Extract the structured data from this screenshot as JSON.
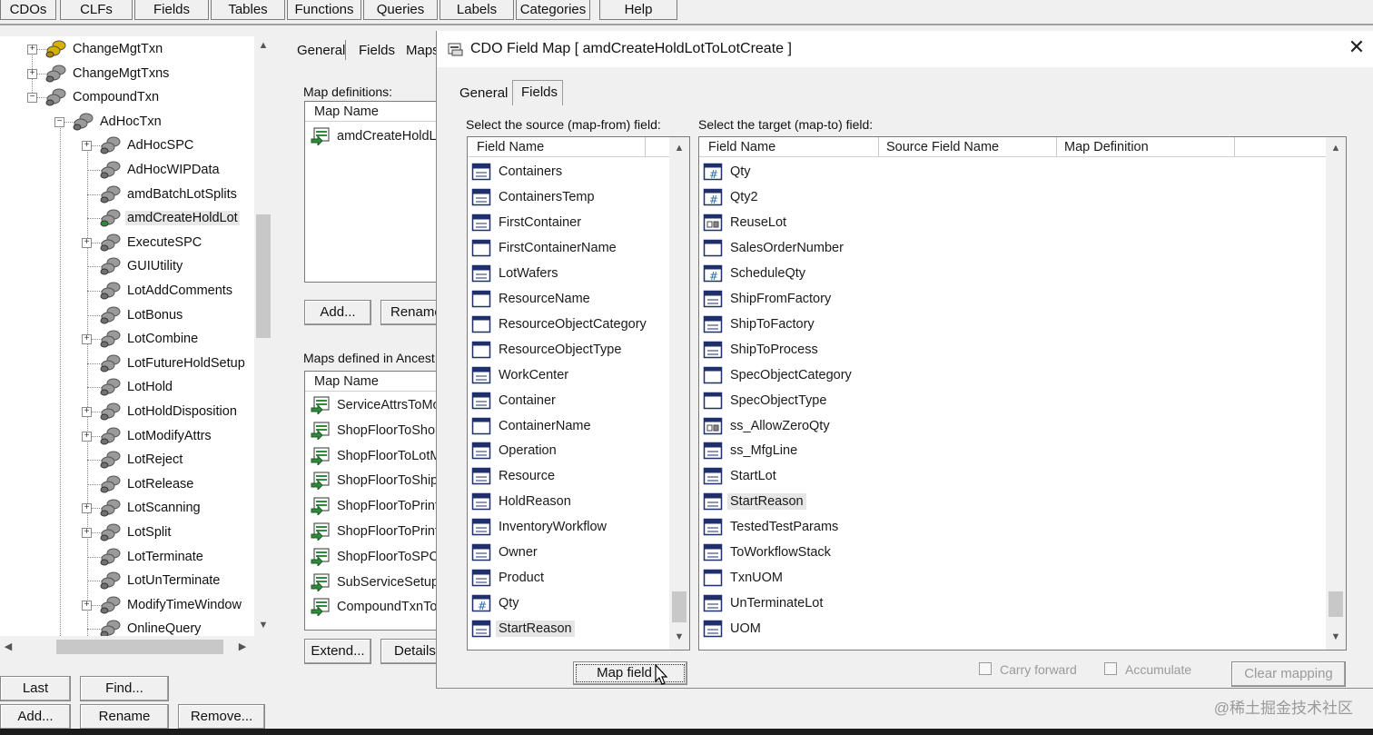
{
  "menu": [
    "CDOs",
    "CLFs",
    "Fields",
    "Tables",
    "Functions",
    "Queries",
    "Labels",
    "Categories",
    "Help"
  ],
  "tree": {
    "items": [
      {
        "label": "ChangeMgtTxn",
        "level": 0,
        "expander": "+",
        "icon": "gold"
      },
      {
        "label": "ChangeMgtTxns",
        "level": 0,
        "expander": "+",
        "icon": "gray"
      },
      {
        "label": "CompoundTxn",
        "level": 0,
        "expander": "-",
        "icon": "gray"
      },
      {
        "label": "AdHocTxn",
        "level": 1,
        "expander": "-",
        "icon": "gray"
      },
      {
        "label": "AdHocSPC",
        "level": 2,
        "expander": "+",
        "icon": "gray"
      },
      {
        "label": "AdHocWIPData",
        "level": 2,
        "expander": "",
        "icon": "gray"
      },
      {
        "label": "amdBatchLotSplits",
        "level": 2,
        "expander": "",
        "icon": "gray"
      },
      {
        "label": "amdCreateHoldLot",
        "level": 2,
        "expander": "",
        "icon": "green",
        "selected": true
      },
      {
        "label": "ExecuteSPC",
        "level": 2,
        "expander": "+",
        "icon": "gray"
      },
      {
        "label": "GUIUtility",
        "level": 2,
        "expander": "",
        "icon": "gray"
      },
      {
        "label": "LotAddComments",
        "level": 2,
        "expander": "",
        "icon": "gray"
      },
      {
        "label": "LotBonus",
        "level": 2,
        "expander": "",
        "icon": "gray"
      },
      {
        "label": "LotCombine",
        "level": 2,
        "expander": "+",
        "icon": "gray"
      },
      {
        "label": "LotFutureHoldSetup",
        "level": 2,
        "expander": "",
        "icon": "gray"
      },
      {
        "label": "LotHold",
        "level": 2,
        "expander": "",
        "icon": "gray"
      },
      {
        "label": "LotHoldDisposition",
        "level": 2,
        "expander": "+",
        "icon": "gray"
      },
      {
        "label": "LotModifyAttrs",
        "level": 2,
        "expander": "+",
        "icon": "gray"
      },
      {
        "label": "LotReject",
        "level": 2,
        "expander": "",
        "icon": "gray"
      },
      {
        "label": "LotRelease",
        "level": 2,
        "expander": "",
        "icon": "gray"
      },
      {
        "label": "LotScanning",
        "level": 2,
        "expander": "+",
        "icon": "gray"
      },
      {
        "label": "LotSplit",
        "level": 2,
        "expander": "+",
        "icon": "gray"
      },
      {
        "label": "LotTerminate",
        "level": 2,
        "expander": "",
        "icon": "gray"
      },
      {
        "label": "LotUnTerminate",
        "level": 2,
        "expander": "",
        "icon": "gray"
      },
      {
        "label": "ModifyTimeWindow",
        "level": 2,
        "expander": "+",
        "icon": "gray"
      },
      {
        "label": "OnlineQuery",
        "level": 2,
        "expander": "",
        "icon": "gray"
      }
    ]
  },
  "left_buttons": {
    "last": "Last",
    "find": "Find...",
    "add": "Add...",
    "rename": "Rename",
    "remove": "Remove..."
  },
  "middle": {
    "tabs": [
      "General",
      "Fields",
      "Maps"
    ],
    "map_definitions_label": "Map definitions:",
    "map_name_header": "Map Name",
    "map_definitions": [
      "amdCreateHoldLo"
    ],
    "add_button": "Add...",
    "rename_button": "Rename",
    "ancestors_label": "Maps defined in Ancest",
    "ancestor_header": "Map Name",
    "ancestor_maps": [
      "ServiceAttrsToMo",
      "ShopFloorToShop",
      "ShopFloorToLotM",
      "ShopFloorToShip",
      "ShopFloorToPrint",
      "ShopFloorToPrint",
      "ShopFloorToSPC",
      "SubServiceSetup",
      "CompoundTxnTo"
    ],
    "extend_button": "Extend...",
    "details_button": "Details"
  },
  "dialog": {
    "title": "CDO Field Map [ amdCreateHoldLotToLotCreate ]",
    "tabs": [
      "General",
      "Fields"
    ],
    "source_label": "Select the source (map-from) field:",
    "target_label": "Select the target (map-to) field:",
    "source_header": "Field Name",
    "target_headers": [
      "Field Name",
      "Source Field Name",
      "Map Definition"
    ],
    "source_fields": [
      {
        "name": "Containers",
        "icon": "object"
      },
      {
        "name": "ContainersTemp",
        "icon": "object"
      },
      {
        "name": "FirstContainer",
        "icon": "object"
      },
      {
        "name": "FirstContainerName",
        "icon": "plain"
      },
      {
        "name": "LotWafers",
        "icon": "object"
      },
      {
        "name": "ResourceName",
        "icon": "plain"
      },
      {
        "name": "ResourceObjectCategory",
        "icon": "plain"
      },
      {
        "name": "ResourceObjectType",
        "icon": "plain"
      },
      {
        "name": "WorkCenter",
        "icon": "object"
      },
      {
        "name": "Container",
        "icon": "object"
      },
      {
        "name": "ContainerName",
        "icon": "plain"
      },
      {
        "name": "Operation",
        "icon": "object"
      },
      {
        "name": "Resource",
        "icon": "object"
      },
      {
        "name": "HoldReason",
        "icon": "object"
      },
      {
        "name": "InventoryWorkflow",
        "icon": "object"
      },
      {
        "name": "Owner",
        "icon": "object"
      },
      {
        "name": "Product",
        "icon": "object"
      },
      {
        "name": "Qty",
        "icon": "number"
      },
      {
        "name": "StartReason",
        "icon": "object",
        "selected": true
      }
    ],
    "target_fields": [
      {
        "name": "Qty",
        "icon": "number"
      },
      {
        "name": "Qty2",
        "icon": "number"
      },
      {
        "name": "ReuseLot",
        "icon": "bool"
      },
      {
        "name": "SalesOrderNumber",
        "icon": "plain"
      },
      {
        "name": "ScheduleQty",
        "icon": "number"
      },
      {
        "name": "ShipFromFactory",
        "icon": "object"
      },
      {
        "name": "ShipToFactory",
        "icon": "object"
      },
      {
        "name": "ShipToProcess",
        "icon": "object"
      },
      {
        "name": "SpecObjectCategory",
        "icon": "plain"
      },
      {
        "name": "SpecObjectType",
        "icon": "plain"
      },
      {
        "name": "ss_AllowZeroQty",
        "icon": "bool"
      },
      {
        "name": "ss_MfgLine",
        "icon": "object"
      },
      {
        "name": "StartLot",
        "icon": "object"
      },
      {
        "name": "StartReason",
        "icon": "object",
        "selected": true
      },
      {
        "name": "TestedTestParams",
        "icon": "object"
      },
      {
        "name": "ToWorkflowStack",
        "icon": "object"
      },
      {
        "name": "TxnUOM",
        "icon": "plain"
      },
      {
        "name": "UnTerminateLot",
        "icon": "object"
      },
      {
        "name": "UOM",
        "icon": "object"
      }
    ],
    "map_field_button": "Map field >",
    "carry_forward_label": "Carry forward",
    "accumulate_label": "Accumulate",
    "clear_mapping_button": "Clear mapping"
  },
  "watermark": "@稀土掘金技术社区",
  "colors": {
    "background": "#f0f0f0",
    "selected_row": "#e6e6e6",
    "icon_navy": "#1f2f6b",
    "icon_green": "#2e8b3a",
    "icon_gold": "#c8a000"
  }
}
